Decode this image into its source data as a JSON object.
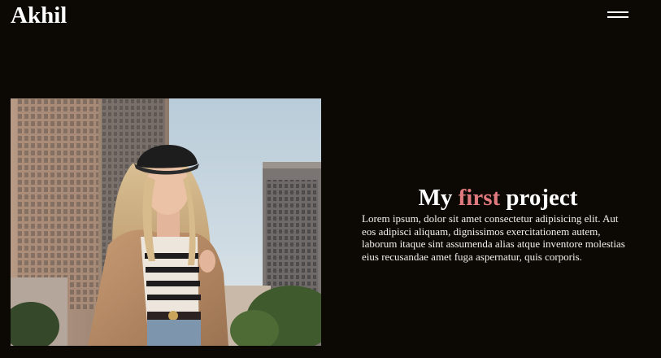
{
  "header": {
    "logo": "Akhil",
    "menu_icon": "hamburger-menu-icon"
  },
  "project": {
    "image_alt": "woman-in-city-photo",
    "title_part1": "My",
    "title_accent": "first",
    "title_part2": "project",
    "description": "Lorem ipsum, dolor sit amet consectetur adipisicing elit. Aut eos adipisci aliquam, dignissimos exercitationem autem, laborum itaque sint assumenda alias atque inventore molestias eius recusandae amet fuga aspernatur, quis corporis."
  },
  "colors": {
    "background": "#0c0905",
    "accent": "#e07a7e",
    "text": "#ffffff"
  }
}
